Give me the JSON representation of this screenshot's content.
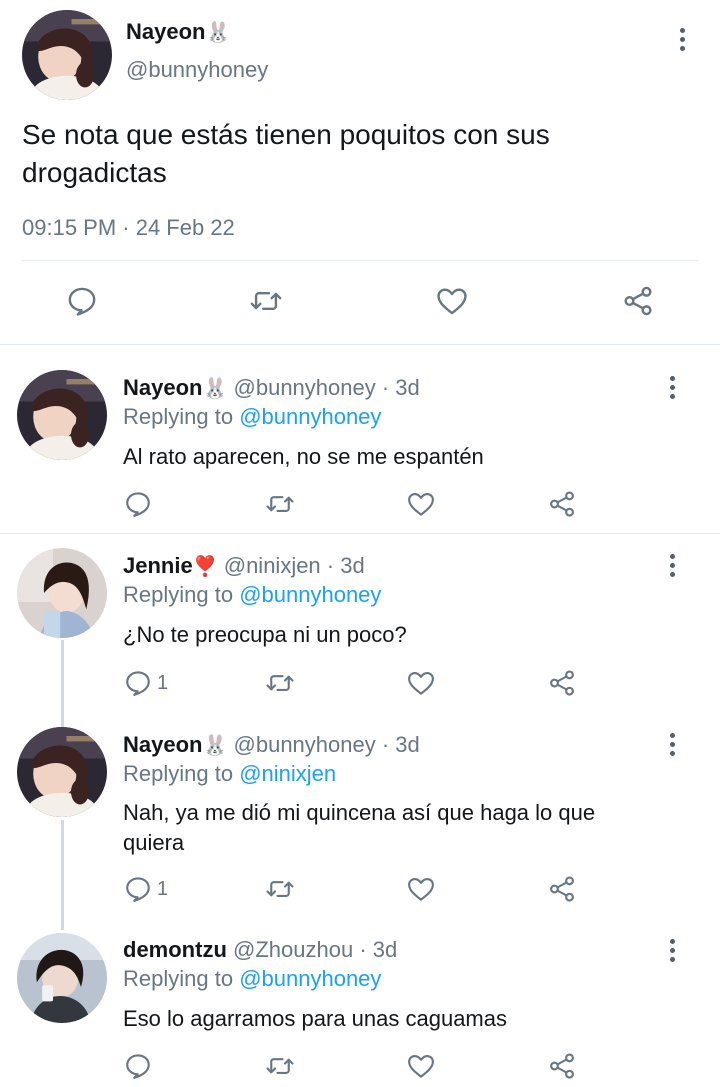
{
  "main_tweet": {
    "author_name": "Nayeon",
    "author_emoji": "🐰",
    "handle": "@bunnyhoney",
    "text_line1": "Se nota que estás tienen poquitos con sus",
    "text_line2": "drogadictas",
    "timestamp": "09:15 PM · 24 Feb 22"
  },
  "replies": [
    {
      "author_name": "Nayeon",
      "author_emoji": "🐰",
      "handle": "@bunnyhoney",
      "age": "· 3d",
      "replying_prefix": "Replying to",
      "replying_to": "@bunnyhoney",
      "text_line1": "Al rato aparecen, no se me espantén",
      "text_line2": "",
      "reply_count": ""
    },
    {
      "author_name": "Jennie",
      "author_emoji": "❣️",
      "handle": "@ninixjen",
      "age": "· 3d",
      "replying_prefix": "Replying to",
      "replying_to": "@bunnyhoney",
      "text_line1": "¿No te preocupa ni un poco?",
      "text_line2": "",
      "reply_count": "1"
    },
    {
      "author_name": "Nayeon",
      "author_emoji": "🐰",
      "handle": "@bunnyhoney",
      "age": "· 3d",
      "replying_prefix": "Replying to",
      "replying_to": "@ninixjen",
      "text_line1": "Nah, ya me dió mi quincena así que haga lo que",
      "text_line2": "quiera",
      "reply_count": "1"
    },
    {
      "author_name": "demontzu",
      "author_emoji": "",
      "handle": "@Zhouzhou",
      "age": "· 3d",
      "replying_prefix": "Replying to",
      "replying_to": "@bunnyhoney",
      "text_line1": "Eso lo agarramos para unas caguamas",
      "text_line2": "",
      "reply_count": ""
    }
  ],
  "colors": {
    "link": "#1da1f2",
    "muted": "#687684",
    "icon": "#687684",
    "divider": "#e6ecf0",
    "heart_emoji": "#e0245e"
  },
  "icons": {
    "reply": "reply-icon",
    "retweet": "retweet-icon",
    "like": "like-icon",
    "share": "share-icon",
    "more": "more-options-icon"
  }
}
